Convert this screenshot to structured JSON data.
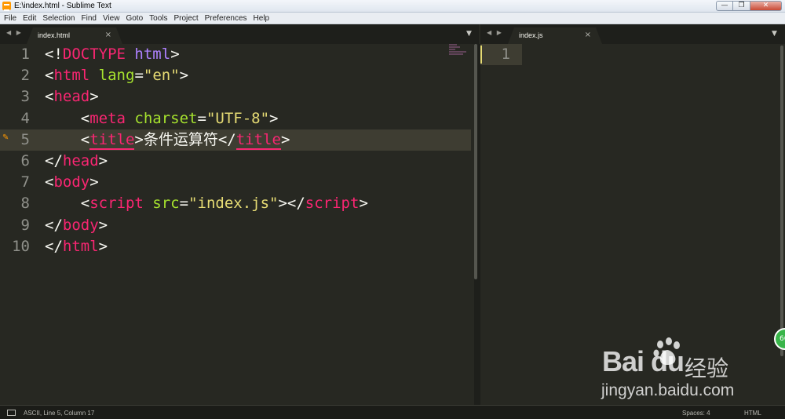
{
  "window": {
    "title": "E:\\index.html - Sublime Text",
    "controls": {
      "minimize": "—",
      "maximize": "❐",
      "close": "✕"
    }
  },
  "menu": [
    "File",
    "Edit",
    "Selection",
    "Find",
    "View",
    "Goto",
    "Tools",
    "Project",
    "Preferences",
    "Help"
  ],
  "tabs": {
    "left": {
      "label": "index.html",
      "close": "×",
      "nav": "◀ ▶",
      "dropdown": "▼"
    },
    "right": {
      "label": "index.js",
      "close": "×",
      "nav": "◀ ▶",
      "dropdown": "▼"
    }
  },
  "editor_left": {
    "line_numbers": [
      "1",
      "2",
      "3",
      "4",
      "5",
      "6",
      "7",
      "8",
      "9",
      "10"
    ],
    "lines": [
      [
        {
          "t": "<!",
          "c": "plain"
        },
        {
          "t": "DOCTYPE",
          "c": "tag"
        },
        {
          "t": " ",
          "c": "plain"
        },
        {
          "t": "html",
          "c": "kw"
        },
        {
          "t": ">",
          "c": "plain"
        }
      ],
      [
        {
          "t": "<",
          "c": "plain"
        },
        {
          "t": "html",
          "c": "tag"
        },
        {
          "t": " ",
          "c": "plain"
        },
        {
          "t": "lang",
          "c": "attr"
        },
        {
          "t": "=",
          "c": "plain"
        },
        {
          "t": "\"en\"",
          "c": "str"
        },
        {
          "t": ">",
          "c": "plain"
        }
      ],
      [
        {
          "t": "<",
          "c": "plain"
        },
        {
          "t": "head",
          "c": "tag"
        },
        {
          "t": ">",
          "c": "plain"
        }
      ],
      [
        {
          "t": "    <",
          "c": "plain"
        },
        {
          "t": "meta",
          "c": "tag"
        },
        {
          "t": " ",
          "c": "plain"
        },
        {
          "t": "charset",
          "c": "attr"
        },
        {
          "t": "=",
          "c": "plain"
        },
        {
          "t": "\"UTF-8\"",
          "c": "str"
        },
        {
          "t": ">",
          "c": "plain"
        }
      ],
      [
        {
          "t": "    <",
          "c": "plain"
        },
        {
          "t": "title",
          "c": "tag und"
        },
        {
          "t": ">条件运算符</",
          "c": "plain"
        },
        {
          "t": "title",
          "c": "tag und"
        },
        {
          "t": ">",
          "c": "plain"
        }
      ],
      [
        {
          "t": "</",
          "c": "plain"
        },
        {
          "t": "head",
          "c": "tag"
        },
        {
          "t": ">",
          "c": "plain"
        }
      ],
      [
        {
          "t": "<",
          "c": "plain"
        },
        {
          "t": "body",
          "c": "tag"
        },
        {
          "t": ">",
          "c": "plain"
        }
      ],
      [
        {
          "t": "    <",
          "c": "plain"
        },
        {
          "t": "script",
          "c": "tag"
        },
        {
          "t": " ",
          "c": "plain"
        },
        {
          "t": "src",
          "c": "attr"
        },
        {
          "t": "=",
          "c": "plain"
        },
        {
          "t": "\"index.js\"",
          "c": "str"
        },
        {
          "t": "></",
          "c": "plain"
        },
        {
          "t": "script",
          "c": "tag"
        },
        {
          "t": ">",
          "c": "plain"
        }
      ],
      [
        {
          "t": "</",
          "c": "plain"
        },
        {
          "t": "body",
          "c": "tag"
        },
        {
          "t": ">",
          "c": "plain"
        }
      ],
      [
        {
          "t": "</",
          "c": "plain"
        },
        {
          "t": "html",
          "c": "tag"
        },
        {
          "t": ">",
          "c": "plain"
        }
      ]
    ],
    "current_line": 5
  },
  "editor_right": {
    "line_numbers": [
      "1"
    ],
    "lines": [
      []
    ]
  },
  "statusbar": {
    "position": "ASCII, Line 5, Column 17",
    "spaces": "Spaces: 4",
    "syntax": "HTML"
  },
  "watermark": {
    "logo": "Bai du",
    "cn": "经验",
    "url": "jingyan.baidu.com",
    "badge": "66"
  },
  "colors": {
    "background": "#272822",
    "tag": "#f92672",
    "attr": "#a6e22e",
    "string": "#e6db74",
    "keyword": "#ae81ff",
    "text": "#f8f8f2"
  }
}
